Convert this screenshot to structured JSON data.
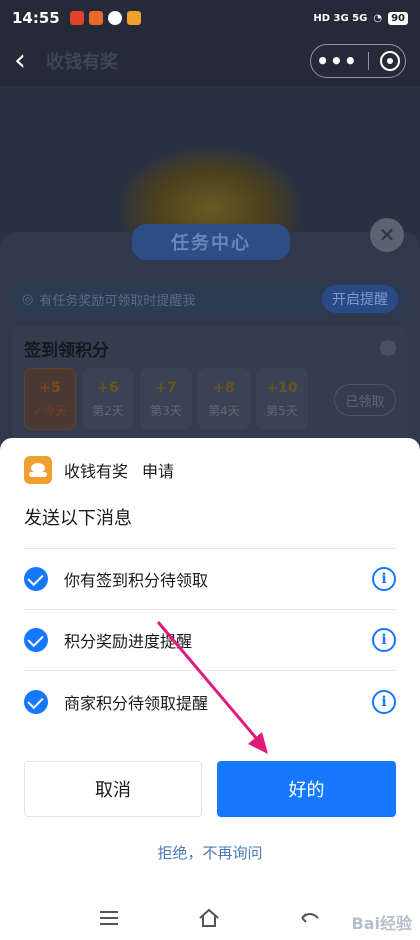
{
  "status_bar": {
    "time": "14:55",
    "network": "HD 3G 5G",
    "battery": "90"
  },
  "nav": {
    "title": "收钱有奖",
    "more_icon": "more-dots-icon",
    "close_icon": "target-circle-icon"
  },
  "background": {
    "task_center": "任务中心",
    "remind_text": "有任务奖励可领取时提醒我",
    "remind_button": "开启提醒",
    "signin_title": "签到领积分",
    "days": [
      {
        "points": "+5",
        "label": "✓今天"
      },
      {
        "points": "+6",
        "label": "第2天"
      },
      {
        "points": "+7",
        "label": "第3天"
      },
      {
        "points": "+8",
        "label": "第4天"
      },
      {
        "points": "+10",
        "label": "第5天"
      }
    ],
    "claimed_button": "已领取"
  },
  "dialog": {
    "app_name": "收钱有奖",
    "action": "申请",
    "title": "发送以下消息",
    "permissions": [
      {
        "label": "你有签到积分待领取"
      },
      {
        "label": "积分奖励进度提醒"
      },
      {
        "label": "商家积分待领取提醒"
      }
    ],
    "cancel": "取消",
    "ok": "好的",
    "refuse": "拒绝，不再询问"
  },
  "watermark": "Bai经验",
  "colors": {
    "primary": "#1677ff",
    "link": "#4a78b8",
    "arrow": "#e0197a"
  }
}
